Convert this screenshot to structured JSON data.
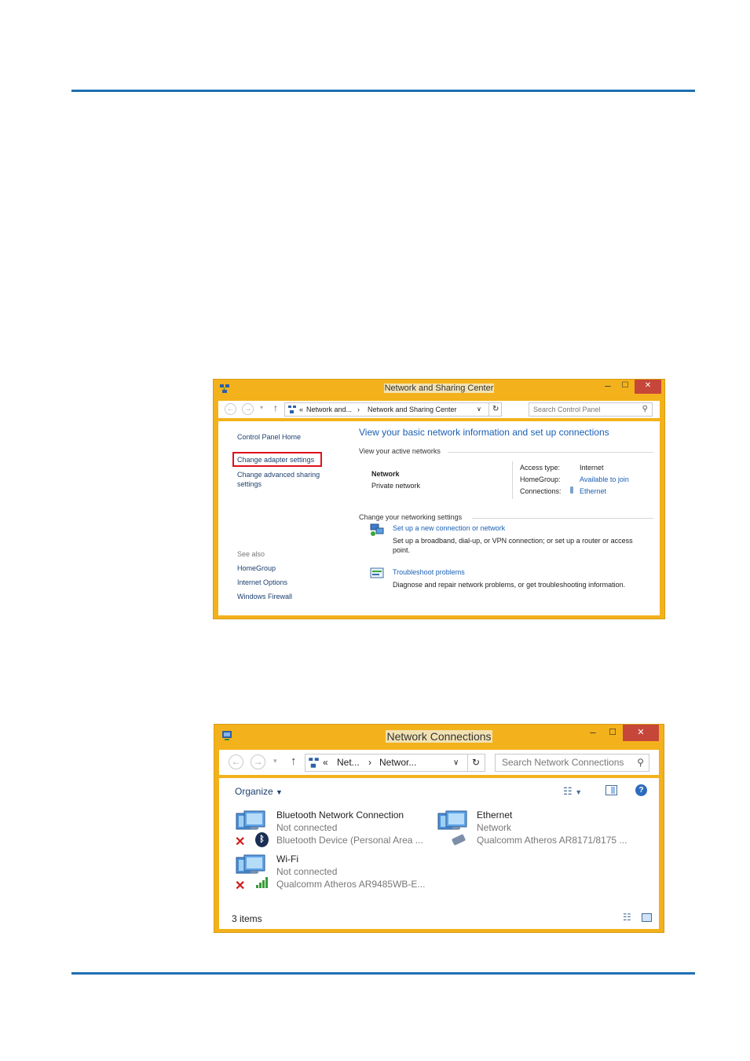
{
  "win1": {
    "title": "Network and Sharing Center",
    "controls": {
      "minimize": "–",
      "maximize": "☐",
      "close": "✕"
    },
    "breadcrumb": {
      "prefix": "«",
      "part1": "Network and...",
      "separator": "›",
      "part2": "Network and Sharing Center"
    },
    "search_placeholder": "Search Control Panel",
    "sidebar": {
      "home": "Control Panel Home",
      "adapter": "Change adapter settings",
      "advanced_line1": "Change advanced sharing",
      "advanced_line2": "settings",
      "see_also": "See also",
      "links": [
        "HomeGroup",
        "Internet Options",
        "Windows Firewall"
      ]
    },
    "main": {
      "heading": "View your basic network information and set up connections",
      "active_networks": "View your active networks",
      "network_name": "Network",
      "network_type": "Private network",
      "access_type_label": "Access type:",
      "access_type_value": "Internet",
      "homegroup_label": "HomeGroup:",
      "homegroup_value": "Available to join",
      "connections_label": "Connections:",
      "connections_value": "Ethernet",
      "change_settings": "Change your networking settings",
      "setup_link": "Set up a new connection or network",
      "setup_desc_line1": "Set up a broadband, dial-up, or VPN connection; or set up a router or access",
      "setup_desc_line2": "point.",
      "troubleshoot_link": "Troubleshoot problems",
      "troubleshoot_desc": "Diagnose and repair network problems, or get troubleshooting information."
    }
  },
  "win2": {
    "title": "Network Connections",
    "controls": {
      "minimize": "–",
      "maximize": "☐",
      "close": "✕"
    },
    "breadcrumb": {
      "prefix": "«",
      "part1": "Net...",
      "separator": "›",
      "part2": "Networ..."
    },
    "search_placeholder": "Search Network Connections",
    "organize": "Organize",
    "items": [
      {
        "name": "Bluetooth Network Connection",
        "status": "Not connected",
        "device": "Bluetooth Device (Personal Area ..."
      },
      {
        "name": "Ethernet",
        "status": "Network",
        "device": "Qualcomm Atheros AR8171/8175 ..."
      },
      {
        "name": "Wi-Fi",
        "status": "Not connected",
        "device": "Qualcomm Atheros AR9485WB-E..."
      }
    ],
    "status_bar": "3 items"
  },
  "colors": {
    "accent_rule": "#1f6fb2",
    "window_frame": "#f3b21b",
    "link": "#1a5fb4",
    "highlight_box": "#e0101a"
  },
  "icons": [
    "network-and-sharing-icon",
    "back-arrow-icon",
    "forward-arrow-icon",
    "up-arrow-icon",
    "refresh-icon",
    "search-icon",
    "network-computer-icon",
    "troubleshoot-icon",
    "bluetooth-icon",
    "wifi-signal-icon",
    "disconnected-x-icon",
    "ethernet-cable-icon",
    "help-icon"
  ]
}
